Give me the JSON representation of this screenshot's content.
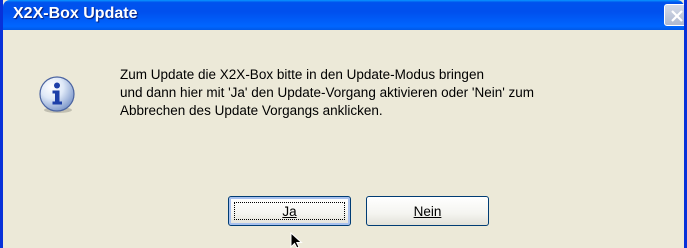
{
  "window": {
    "title": "X2X-Box Update"
  },
  "icons": {
    "info": "info-icon",
    "close": "close-icon",
    "cursor": "mouse-pointer-icon"
  },
  "message": {
    "lines": [
      "Zum Update die X2X-Box bitte in den Update-Modus bringen",
      "und dann hier mit 'Ja' den Update-Vorgang aktivieren oder 'Nein' zum",
      "Abbrechen des Update Vorgangs anklicken."
    ]
  },
  "buttons": {
    "yes_label": "Ja",
    "no_label": "Nein"
  },
  "colors": {
    "titlebar": "#0053ee",
    "frame": "#0831d9",
    "dialog_background": "#ece9d8",
    "button_border": "#003c74"
  }
}
